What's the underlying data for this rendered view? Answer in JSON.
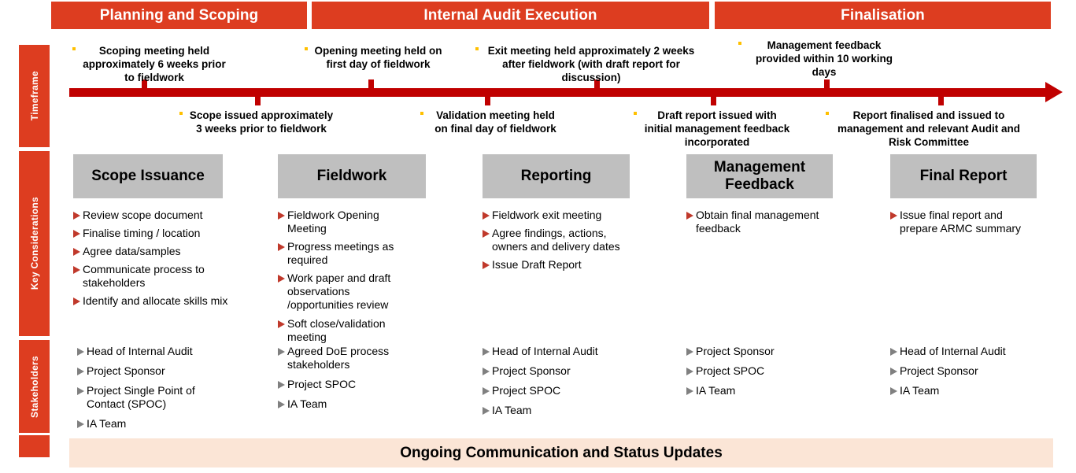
{
  "phases": [
    {
      "label": "Planning and Scoping"
    },
    {
      "label": "Internal Audit Execution"
    },
    {
      "label": "Finalisation"
    }
  ],
  "rails": {
    "timeframe": "Timeframe",
    "key_considerations": "Key Considerations",
    "stakeholders": "Stakeholders"
  },
  "timeline": {
    "above": [
      {
        "text": "Scoping meeting held approximately 6 weeks prior to fieldwork"
      },
      {
        "text": "Opening meeting held on first day of fieldwork"
      },
      {
        "text": "Exit meeting held approximately 2 weeks after fieldwork (with draft report for discussion)"
      },
      {
        "text": "Management feedback provided within 10 working days"
      }
    ],
    "below": [
      {
        "text": "Scope issued approximately 3 weeks prior to fieldwork"
      },
      {
        "text": "Validation meeting held on final day of fieldwork"
      },
      {
        "text": "Draft report issued with initial management feedback incorporated"
      },
      {
        "text": "Report finalised and issued to management and relevant Audit and Risk Committee"
      }
    ]
  },
  "stages": [
    {
      "title": "Scope Issuance",
      "considerations": [
        "Review scope document",
        "Finalise timing / location",
        "Agree data/samples",
        "Communicate process to stakeholders",
        "Identify and allocate skills mix"
      ],
      "stakeholders": [
        "Head of Internal Audit",
        "Project Sponsor",
        " Project Single Point of Contact (SPOC)",
        "IA Team"
      ]
    },
    {
      "title": "Fieldwork",
      "considerations": [
        "Fieldwork Opening Meeting",
        "Progress meetings as required",
        "Work paper and draft observations /opportunities review",
        "Soft close/validation meeting"
      ],
      "stakeholders": [
        "Agreed DoE process stakeholders",
        "Project SPOC",
        "IA Team"
      ]
    },
    {
      "title": "Reporting",
      "considerations": [
        "Fieldwork exit meeting",
        "Agree findings, actions, owners and delivery dates",
        "Issue Draft Report"
      ],
      "stakeholders": [
        "Head of Internal Audit",
        "Project Sponsor",
        "Project SPOC",
        "IA Team"
      ]
    },
    {
      "title": "Management Feedback",
      "considerations": [
        "Obtain final management feedback"
      ],
      "stakeholders": [
        "Project Sponsor",
        "Project SPOC",
        "IA Team"
      ]
    },
    {
      "title": "Final Report",
      "considerations": [
        "Issue final report and prepare ARMC summary"
      ],
      "stakeholders": [
        "Head of Internal Audit",
        "Project Sponsor",
        "IA Team"
      ]
    }
  ],
  "footer": {
    "banner": "Ongoing Communication and Status Updates"
  },
  "colors": {
    "phase_bar": "#DD3D20",
    "timeline": "#C00000",
    "stage_box": "#BFBFBF",
    "bullet_red": "#C0392B",
    "bullet_gray": "#808080",
    "banner_bg": "#FBE5D6",
    "tick_dot": "#FFC000"
  }
}
